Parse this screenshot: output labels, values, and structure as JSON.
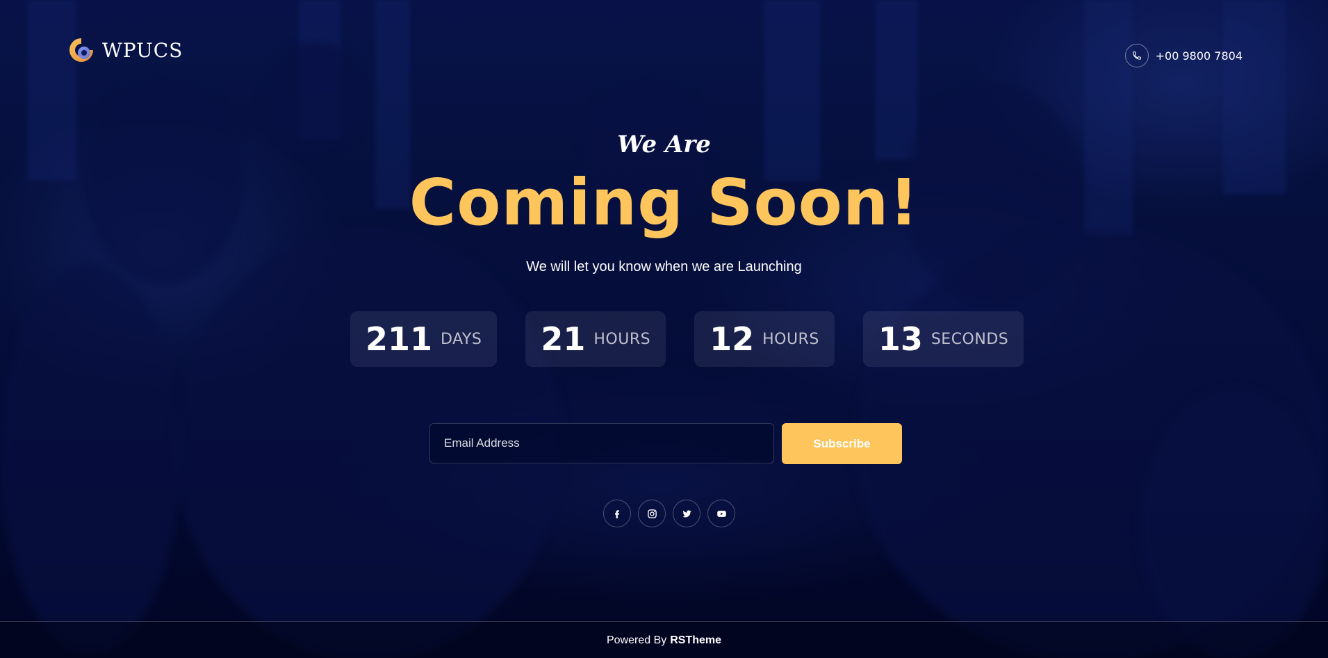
{
  "header": {
    "logo_text": "WPUCS",
    "phone": "+00 9800 7804"
  },
  "hero": {
    "kicker": "We Are",
    "title": "Coming Soon!",
    "subtitle": "We will let you know when we are Launching"
  },
  "countdown": [
    {
      "value": "211",
      "unit": "DAYS"
    },
    {
      "value": "21",
      "unit": "HOURS"
    },
    {
      "value": "12",
      "unit": "HOURS"
    },
    {
      "value": "13",
      "unit": "SECONDS"
    }
  ],
  "subscribe": {
    "placeholder": "Email Address",
    "button": "Subscribe"
  },
  "social": [
    "facebook-icon",
    "instagram-icon",
    "twitter-icon",
    "youtube-icon"
  ],
  "footer": {
    "prefix": "Powered By",
    "brand": "RSTheme"
  },
  "colors": {
    "accent": "#fdc55c",
    "background": "#061040"
  }
}
